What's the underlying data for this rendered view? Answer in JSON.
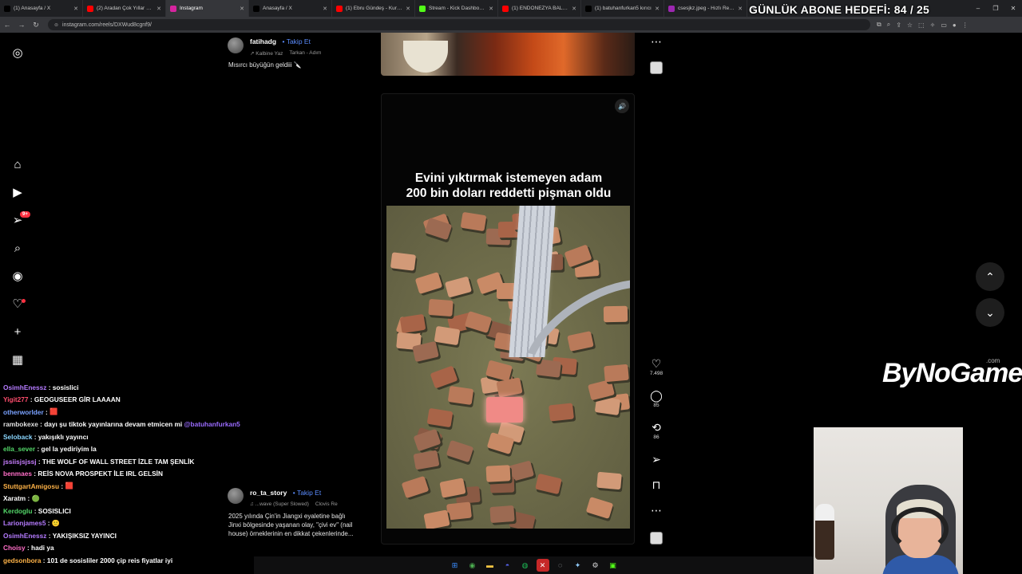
{
  "browser": {
    "tabs": [
      {
        "label": "(1) Anasayfa / X",
        "icon": "x-logo-icon",
        "color": "#000000"
      },
      {
        "label": "(2) Aradan Çok Yıllar Geçti",
        "icon": "youtube-icon",
        "color": "#ff0000"
      },
      {
        "label": "Instagram",
        "icon": "instagram-icon",
        "color": "#d6249f",
        "active": true
      },
      {
        "label": "Anasayfa / X",
        "icon": "x-logo-icon",
        "color": "#000000"
      },
      {
        "label": "(1) Ebru Gündeş - Kurşun",
        "icon": "youtube-icon",
        "color": "#ff0000"
      },
      {
        "label": "Stream - Kick Dashboard",
        "icon": "kick-icon",
        "color": "#53fc18"
      },
      {
        "label": "(1) ENDONEZYA BALLBU",
        "icon": "youtube-icon",
        "color": "#ff0000"
      },
      {
        "label": "(1) batuhanfurkan5 kırıcı",
        "icon": "x-logo-icon",
        "color": "#000000"
      },
      {
        "label": "csesjkz.jpeg - Hızlı Resim",
        "icon": "image-icon",
        "color": "#9c27b0"
      }
    ],
    "url": "instagram.com/reels/DXWud8cgnf9/",
    "window_controls": [
      "–",
      "❐",
      "✕"
    ]
  },
  "stream_overlay": {
    "goal_text": "GÜNLÜK ABONE HEDEFİ: 84 / 25",
    "logo": "ByNoGame",
    "logo_suffix": ".com"
  },
  "instagram": {
    "nav_icons": [
      "instagram-logo-icon",
      "home-icon",
      "reels-icon",
      "direct-icon",
      "search-icon",
      "explore-icon",
      "notifications-icon",
      "create-icon",
      "dashboard-icon"
    ],
    "direct_badge": "9+",
    "prev_post": {
      "author": "fatihadg",
      "follow": "Takip Et",
      "audio_a": "Kalbine Yaz",
      "audio_b": "Tarkan - Adım",
      "caption": "Mısırcı büyüğün geldiii 🔪"
    },
    "current_post": {
      "author": "ro_ta_story",
      "follow": "Takip Et",
      "audio_a": "...wave (Super Slowed)",
      "audio_b": "Clovis Re",
      "caption_lines": [
        "2025 yılında Çin'in Jiangxi eyaletine bağlı",
        "Jinxi bölgesinde yaşanan olay, \"çivi ev\" (nail",
        "house) örneklerinin en dikkat çekenlerinde..."
      ],
      "video_title_line1": "Evini yıktırmak istemeyen adam",
      "video_title_line2": "200 bin doları reddetti pişman oldu",
      "likes": "7.498",
      "comments": "85",
      "reposts": "86"
    }
  },
  "chat": [
    {
      "user": "OsimhEnessz",
      "color": "#b57bff",
      "text": "sosislici"
    },
    {
      "user": "Yigit277",
      "color": "#ff4d6d",
      "text": "GEOGUSEER GİR LAAAAN"
    },
    {
      "user": "otherworlder",
      "color": "#7aa2ff",
      "text": "🟥"
    },
    {
      "user": "rambokexe",
      "color": "#e0e0e0",
      "text": "dayı şu tiktok yayınlarına devam etmicen mi",
      "mention": "@batuhanfurkan5"
    },
    {
      "user": "Seloback",
      "color": "#8ad6ff",
      "text": "yakışıklı yayıncı"
    },
    {
      "user": "ella_sever",
      "color": "#53d769",
      "text": "gel la yediriyim la"
    },
    {
      "user": "jssiisjsjssj",
      "color": "#c77dff",
      "text": "THE WOLF OF WALL STREET İZLE TAM ŞENLİK"
    },
    {
      "user": "benmaes",
      "color": "#ff6ec7",
      "text": "REİS NOVA PROSPEKT İLE IRL GELSİN"
    },
    {
      "user": "StuttgartAmigosu",
      "color": "#ffb347",
      "text": "🟥"
    },
    {
      "user": "Xaratm",
      "color": "#ffffff",
      "text": "🟢"
    },
    {
      "user": "Kerdoglu",
      "color": "#53d769",
      "text": "SOSISLICI"
    },
    {
      "user": "Larionjames5",
      "color": "#b57bff",
      "text": "🙂"
    },
    {
      "user": "OsimhEnessz",
      "color": "#b57bff",
      "text": "YAKIŞIKSIZ YAYINCI"
    },
    {
      "user": "Choisy",
      "color": "#ff6ec7",
      "text": "hadi ya"
    },
    {
      "user": "gedsonbora",
      "color": "#ffb347",
      "text": "101 de sosisliler 2000 çip reis fiyatlar iyi"
    }
  ]
}
